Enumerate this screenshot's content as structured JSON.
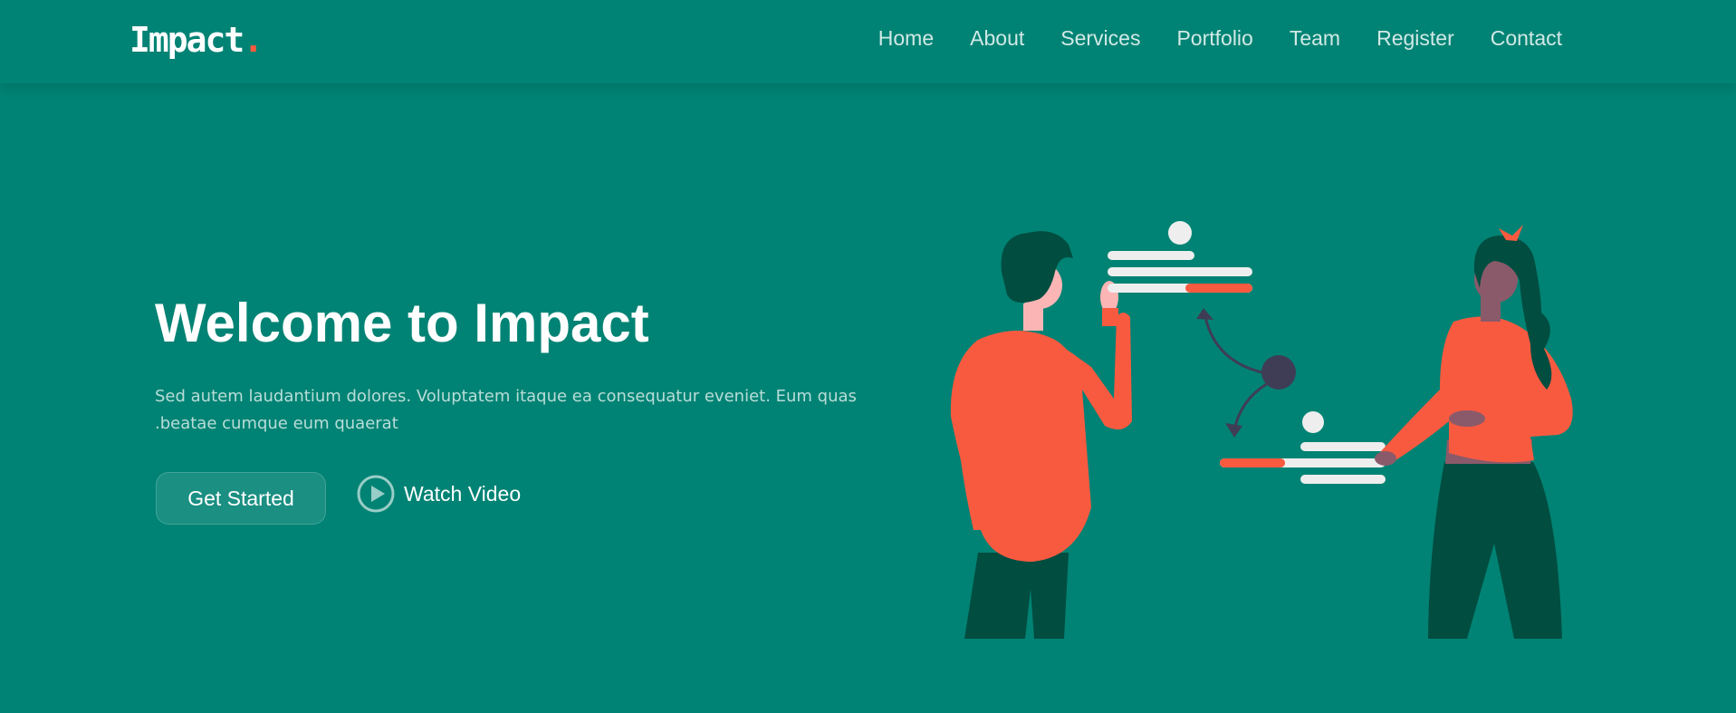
{
  "brand": {
    "name": "Impact",
    "dot": ".",
    "accent_color": "#f85a40",
    "background_color": "#008374"
  },
  "nav": {
    "items": [
      {
        "label": "Home"
      },
      {
        "label": "About"
      },
      {
        "label": "Services"
      },
      {
        "label": "Portfolio"
      },
      {
        "label": "Team"
      },
      {
        "label": "Register"
      },
      {
        "label": "Contact"
      }
    ]
  },
  "hero": {
    "title": "Welcome to Impact",
    "text": "Sed autem laudantium dolores. Voluptatem itaque ea consequatur eveniet. Eum quas .beatae cumque eum quaerat",
    "primary_button": "Get Started",
    "secondary_button": "Watch Video",
    "secondary_icon": "play-circle-icon",
    "illustration": "people-collaborating-illustration"
  }
}
